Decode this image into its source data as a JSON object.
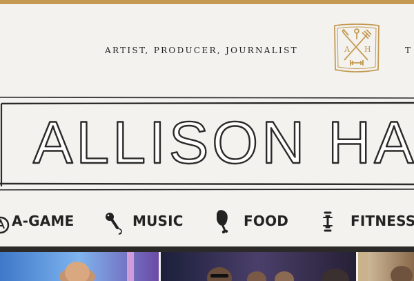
{
  "header": {
    "tagline": "ARTIST, PRODUCER, JOURNALIST",
    "tagline_overflow": "T",
    "logo_letters": [
      "A",
      "H"
    ],
    "banner_title": "ALLISON HAGENDORF"
  },
  "nav": {
    "items": [
      {
        "label": "A-GAME",
        "icon": "a-game-icon"
      },
      {
        "label": "MUSIC",
        "icon": "microphone-icon"
      },
      {
        "label": "FOOD",
        "icon": "drumstick-icon"
      },
      {
        "label": "FITNESS",
        "icon": "dumbbell-icon"
      }
    ]
  },
  "colors": {
    "accent_gold": "#c49a52",
    "ink": "#222222",
    "background": "#f3f2ef",
    "divider": "#2b2a28"
  }
}
